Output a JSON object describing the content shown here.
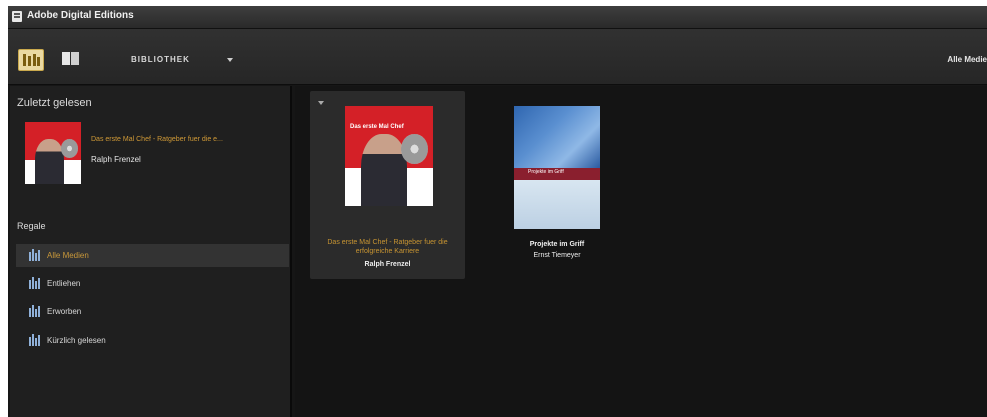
{
  "window": {
    "title": "Adobe Digital Editions"
  },
  "toolbar": {
    "views": [
      {
        "name": "bookshelf-view",
        "icon": "bookshelf-icon",
        "active": true
      },
      {
        "name": "reading-view",
        "icon": "reading-view-icon",
        "active": false
      }
    ],
    "library_label": "BIBLIOTHEK",
    "library_dropdown_icon": "chevron-down-icon",
    "filter_label": "Alle Medie"
  },
  "sidebar": {
    "recent_title": "Zuletzt gelesen",
    "recent_book": {
      "title": "Das erste Mal Chef - Ratgeber fuer die e...",
      "author": "Ralph Frenzel"
    },
    "shelves_title": "Regale",
    "shelves": [
      {
        "label": "Alle Medien",
        "selected": true
      },
      {
        "label": "Entliehen",
        "selected": false
      },
      {
        "label": "Erworben",
        "selected": false
      },
      {
        "label": "Kürzlich gelesen",
        "selected": false
      }
    ]
  },
  "library": {
    "books": [
      {
        "title": "Das erste Mal Chef - Ratgeber fuer die erfolgreiche Karriere",
        "author": "Ralph Frenzel",
        "cover_text": "Das erste Mal Chef",
        "selected": true
      },
      {
        "title": "Projekte im Griff",
        "author": "Ernst Tiemeyer",
        "cover_text": "Projekte im Griff",
        "selected": false
      }
    ]
  },
  "colors": {
    "highlight_text": "#c9983a",
    "background": "#141414",
    "sidebar": "#1f1f1f",
    "selected_row": "#333333"
  }
}
